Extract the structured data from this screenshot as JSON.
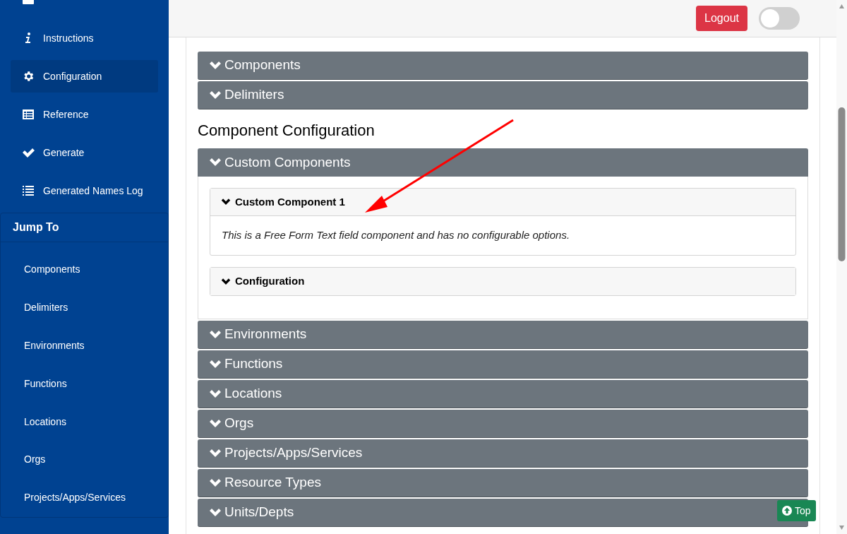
{
  "sidebar": {
    "nav_items": [
      {
        "kind": "log",
        "selected": false
      },
      {
        "label": "Instructions",
        "kind": "info",
        "selected": false
      },
      {
        "label": "Configuration",
        "kind": "gear",
        "selected": true
      },
      {
        "label": "Reference",
        "kind": "table",
        "selected": false
      },
      {
        "label": "Generate",
        "kind": "check",
        "selected": false
      },
      {
        "label": "Generated Names Log",
        "kind": "list",
        "selected": false
      }
    ],
    "jump_to": {
      "title": "Jump To",
      "items": [
        "Components",
        "Delimiters",
        "Environments",
        "Functions",
        "Locations",
        "Orgs",
        "Projects/Apps/Services"
      ]
    }
  },
  "header": {
    "logout": "Logout",
    "toggle": {
      "on": false
    }
  },
  "main": {
    "sections": [
      {
        "panels": [
          {
            "title": "Components",
            "expanded": false
          },
          {
            "title": "Delimiters",
            "expanded": false
          }
        ]
      },
      {
        "title": "Component Configuration",
        "panels": [
          {
            "title": "Custom Components",
            "expanded": true,
            "cards": [
              {
                "title": "Custom Component 1",
                "expanded": true,
                "body": "This is a Free Form Text field component and has no configurable options."
              },
              {
                "title": "Configuration",
                "expanded": false
              }
            ]
          },
          {
            "title": "Environments",
            "expanded": false
          },
          {
            "title": "Functions",
            "expanded": false
          },
          {
            "title": "Locations",
            "expanded": false
          },
          {
            "title": "Orgs",
            "expanded": false
          },
          {
            "title": "Projects/Apps/Services",
            "expanded": false
          },
          {
            "title": "Resource Types",
            "expanded": false
          },
          {
            "title": "Units/Depts",
            "expanded": false
          }
        ]
      }
    ]
  },
  "top_button": "Top"
}
